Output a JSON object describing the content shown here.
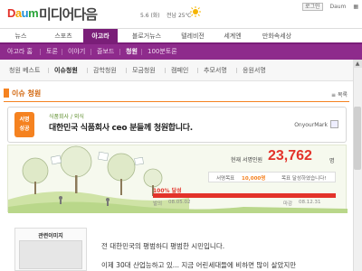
{
  "header": {
    "logo": "Daum",
    "site_title": "미디어다음",
    "date": "5.6 (화)",
    "weather": "전남 25℃",
    "top_links": [
      "로그인",
      "Daum",
      "▦"
    ]
  },
  "main_nav": [
    "뉴스",
    "스포츠",
    "아고라",
    "블로거뉴스",
    "텔레비전",
    "세계엔",
    "만화속세상"
  ],
  "sub_nav": [
    "아고라 홈",
    "토론",
    "이야기",
    "즐보드",
    "청원",
    "100분토론"
  ],
  "third_nav": [
    "청원 베스트",
    "이슈청원",
    "감학청원",
    "모금청원",
    "캠페인",
    "추모서명",
    "응원서명"
  ],
  "section": {
    "title": "이슈 청원",
    "list_button": "목록"
  },
  "petition": {
    "badge_line1": "서명",
    "badge_line2": "성공",
    "category": "식품회사 / 외식",
    "title": "대한민국 식품회사 ceo 분들께 청원합니다.",
    "author": "OnyourMark",
    "count_label": "현재 서명인원",
    "count": "23,762",
    "count_unit": "명",
    "goal_label": "서명목표",
    "goal_value": "10,000명",
    "goal_note": "목표 달성하였습니다!",
    "percent_label": "100% 달성",
    "progress_fraction": 1.0,
    "start_label": "발의",
    "start_date": "08.05.02",
    "end_label": "마감",
    "end_date": "08.12.31"
  },
  "related": {
    "title": "관련이미지"
  },
  "body": {
    "line1": "전 대한민국의 평범하디 평범한 시민입니다.",
    "line2": "이제 30대 산업능하고 있... 지금 어린세대들에 비하면 많이 살았지만"
  },
  "colors": {
    "brand_purple": "#8e2b8c",
    "accent_orange": "#f58220",
    "count_red": "#e3322a"
  }
}
